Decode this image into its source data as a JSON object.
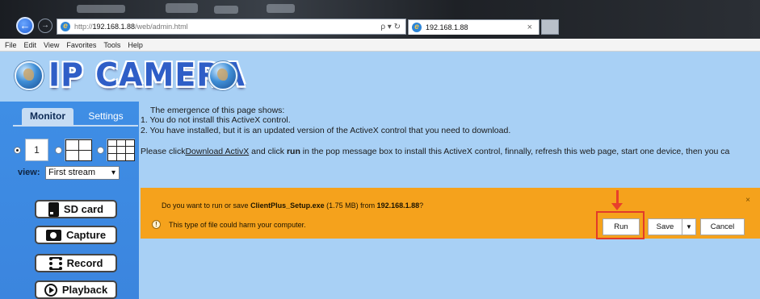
{
  "browser": {
    "url_prefix": "http://",
    "url_host": "192.168.1.88",
    "url_path": "/web/admin.html",
    "address_tools": "ρ ▾ ↻",
    "tab_title": "192.168.1.88",
    "tab_close": "×",
    "menu": [
      "File",
      "Edit",
      "View",
      "Favorites",
      "Tools",
      "Help"
    ]
  },
  "logo": {
    "text": "IP CAMERA"
  },
  "sidebar": {
    "tabs": {
      "monitor": "Monitor",
      "settings": "Settings"
    },
    "split_one_label": "1",
    "view_label": "view:",
    "view_selected": "First stream",
    "buttons": {
      "sd_card": "SD card",
      "capture": "Capture",
      "record": "Record",
      "playback": "Playback"
    }
  },
  "notice": {
    "line1": "The emergence of this page shows:",
    "line2": "1. You do not install this ActiveX control.",
    "line3": "2. You have installed, but it is an updated version of the ActiveX control that you need to download.",
    "line4_pre": "Please click",
    "line4_link": "Download ActivX",
    "line4_mid": " and click ",
    "line4_bold": "run",
    "line4_post": " in the pop message box to install this ActiveX control, finnally, refresh this web page, start one device, then you ca"
  },
  "download_bar": {
    "q_pre": "Do you want to run or save ",
    "filename": "ClientPlus_Setup.exe",
    "q_size": " (1.75 MB) from ",
    "host": "192.168.1.88",
    "q_end": "?",
    "warning": "This type of file could harm your computer.",
    "run": "Run",
    "save": "Save",
    "save_dropdown": "▼",
    "cancel": "Cancel",
    "close": "×"
  }
}
